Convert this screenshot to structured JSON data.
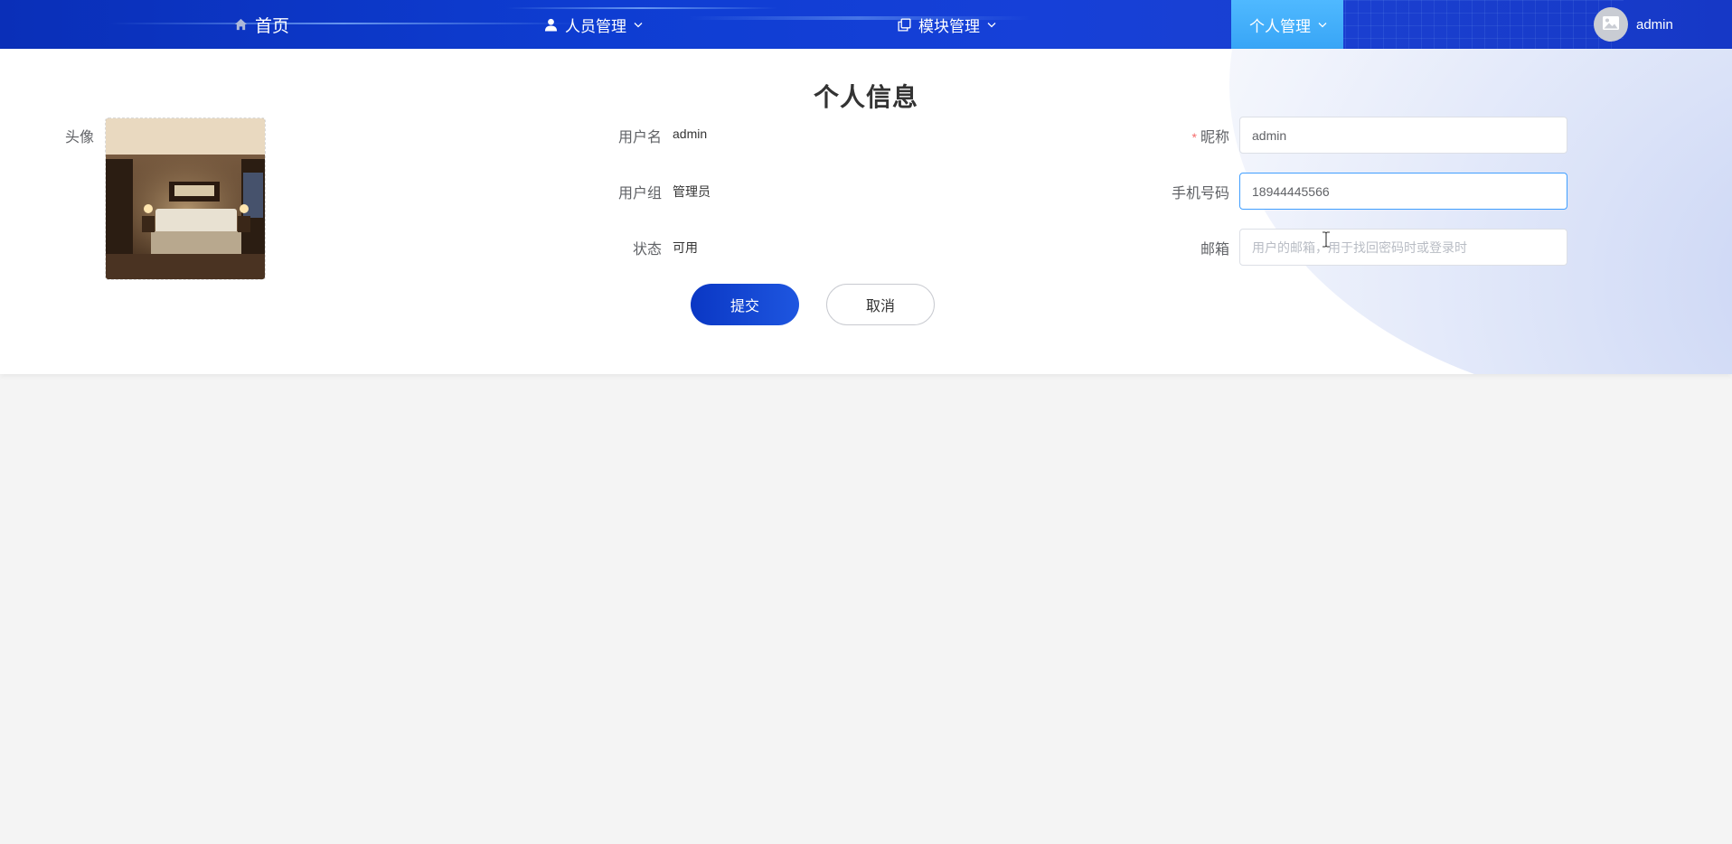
{
  "nav": {
    "home": "首页",
    "users": "人员管理",
    "modules": "模块管理",
    "personal": "个人管理",
    "username": "admin"
  },
  "page": {
    "title": "个人信息"
  },
  "form": {
    "avatar_label": "头像",
    "username_label": "用户名",
    "username_value": "admin",
    "group_label": "用户组",
    "group_value": "管理员",
    "status_label": "状态",
    "status_value": "可用",
    "nickname_required": "*",
    "nickname_label": "昵称",
    "nickname_value": "admin",
    "phone_label": "手机号码",
    "phone_value": "18944445566",
    "email_label": "邮箱",
    "email_placeholder": "用户的邮箱，用于找回密码时或登录时",
    "submit": "提交",
    "cancel": "取消"
  },
  "colors": {
    "nav_bg": "#0e3dd2",
    "nav_active": "#3fa9f8",
    "primary_button": "#0a37c4",
    "required": "#f56c6c",
    "focus_border": "#409eff"
  },
  "icons": {
    "home": "home-icon",
    "users": "user-icon",
    "modules": "copy-icon",
    "avatar": "image-icon"
  }
}
